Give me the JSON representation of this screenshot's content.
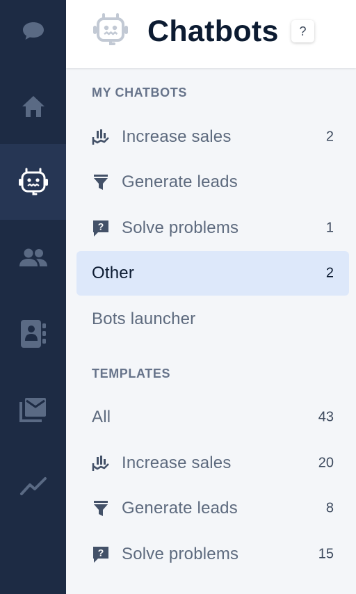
{
  "header": {
    "title": "Chatbots",
    "help_label": "?"
  },
  "my_chatbots": {
    "title": "MY CHATBOTS",
    "items": [
      {
        "label": "Increase sales",
        "count": "2",
        "icon": "chart-hand-icon"
      },
      {
        "label": "Generate leads",
        "count": "",
        "icon": "funnel-icon"
      },
      {
        "label": "Solve problems",
        "count": "1",
        "icon": "question-chat-icon"
      },
      {
        "label": "Other",
        "count": "2",
        "icon": "",
        "active": true
      },
      {
        "label": "Bots launcher",
        "count": "",
        "icon": ""
      }
    ]
  },
  "templates": {
    "title": "TEMPLATES",
    "items": [
      {
        "label": "All",
        "count": "43",
        "icon": ""
      },
      {
        "label": "Increase sales",
        "count": "20",
        "icon": "chart-hand-icon"
      },
      {
        "label": "Generate leads",
        "count": "8",
        "icon": "funnel-icon"
      },
      {
        "label": "Solve problems",
        "count": "15",
        "icon": "question-chat-icon"
      }
    ]
  },
  "rail": {
    "items": [
      {
        "icon": "chat-icon"
      },
      {
        "icon": "home-icon"
      },
      {
        "icon": "bot-icon",
        "active": true
      },
      {
        "icon": "people-icon"
      },
      {
        "icon": "contacts-icon"
      },
      {
        "icon": "inbox-icon"
      },
      {
        "icon": "trend-icon"
      }
    ]
  },
  "colors": {
    "rail_bg": "#1d2b44",
    "rail_active_bg": "#263654",
    "rail_icon": "#66738a",
    "active_item_bg": "#dde8fa",
    "panel_bg": "#f4f6f9"
  }
}
